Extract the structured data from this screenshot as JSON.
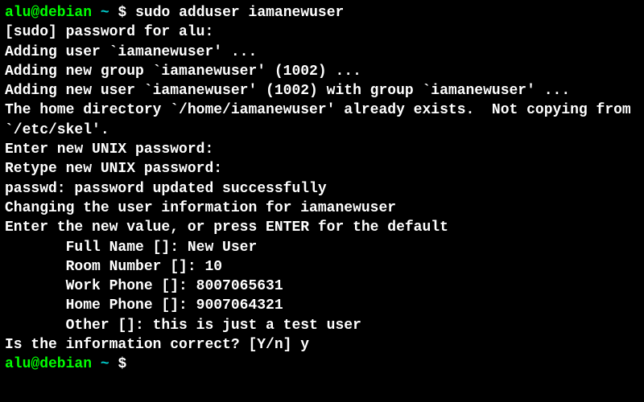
{
  "prompt1": {
    "user_host": "alu@debian",
    "tilde": "~",
    "dollar": "$",
    "command": "sudo adduser iamanewuser"
  },
  "output": {
    "line1": "[sudo] password for alu:",
    "line2": "Adding user `iamanewuser' ...",
    "line3": "Adding new group `iamanewuser' (1002) ...",
    "line4": "Adding new user `iamanewuser' (1002) with group `iamanewuser' ...",
    "line5": "The home directory `/home/iamanewuser' already exists.  Not copying from `/etc/skel'.",
    "line6": "Enter new UNIX password:",
    "line7": "Retype new UNIX password:",
    "line8": "passwd: password updated successfully",
    "line9": "Changing the user information for iamanewuser",
    "line10": "Enter the new value, or press ENTER for the default",
    "fullname": "Full Name []: New User",
    "room": "Room Number []: 10",
    "workphone": "Work Phone []: 8007065631",
    "homephone": "Home Phone []: 9007064321",
    "other": "Other []: this is just a test user",
    "confirm": "Is the information correct? [Y/n] y"
  },
  "prompt2": {
    "user_host": "alu@debian",
    "tilde": "~",
    "dollar": "$"
  }
}
